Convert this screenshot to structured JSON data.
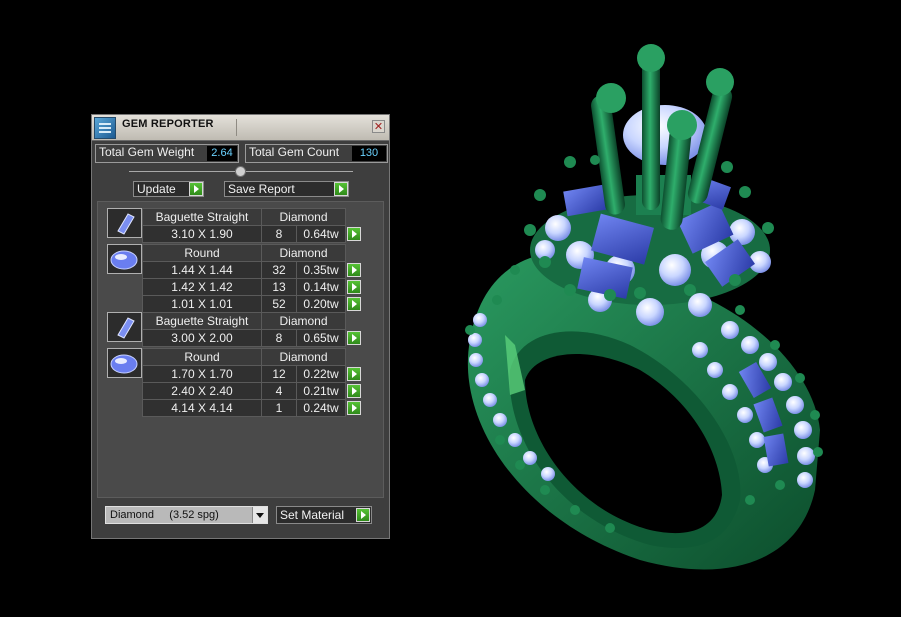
{
  "panel": {
    "title": "GEM REPORTER",
    "close_glyph": "✕",
    "app_icon": "gem-report-icon",
    "total_weight_label": "Total Gem Weight",
    "total_weight_value": "2.64",
    "total_count_label": "Total Gem Count",
    "total_count_value": "130",
    "update_label": "Update",
    "save_label": "Save Report",
    "groups": [
      {
        "shape": "Baguette Straight",
        "material": "Diamond",
        "icon": "baguette-gem-icon",
        "rows": [
          {
            "size": "3.10 X 1.90",
            "count": "8",
            "weight": "0.64tw"
          }
        ]
      },
      {
        "shape": "Round",
        "material": "Diamond",
        "icon": "round-gem-icon",
        "rows": [
          {
            "size": "1.44 X 1.44",
            "count": "32",
            "weight": "0.35tw"
          },
          {
            "size": "1.42 X 1.42",
            "count": "13",
            "weight": "0.14tw"
          },
          {
            "size": "1.01 X 1.01",
            "count": "52",
            "weight": "0.20tw"
          }
        ]
      },
      {
        "shape": "Baguette Straight",
        "material": "Diamond",
        "icon": "baguette-gem-icon",
        "rows": [
          {
            "size": "3.00 X 2.00",
            "count": "8",
            "weight": "0.65tw"
          }
        ]
      },
      {
        "shape": "Round",
        "material": "Diamond",
        "icon": "round-gem-icon",
        "rows": [
          {
            "size": "1.70 X 1.70",
            "count": "12",
            "weight": "0.22tw"
          },
          {
            "size": "2.40 X 2.40",
            "count": "4",
            "weight": "0.21tw"
          },
          {
            "size": "4.14 X 4.14",
            "count": "1",
            "weight": "0.24tw"
          }
        ]
      }
    ],
    "material_select": "Diamond     (3.52 spg)",
    "set_material_label": "Set Material"
  },
  "colors": {
    "accent_green": "#3fa825",
    "value_text": "#6ad2ff",
    "ring_green": "#1e7a4a",
    "gem_blue": "#4b5fd6"
  }
}
